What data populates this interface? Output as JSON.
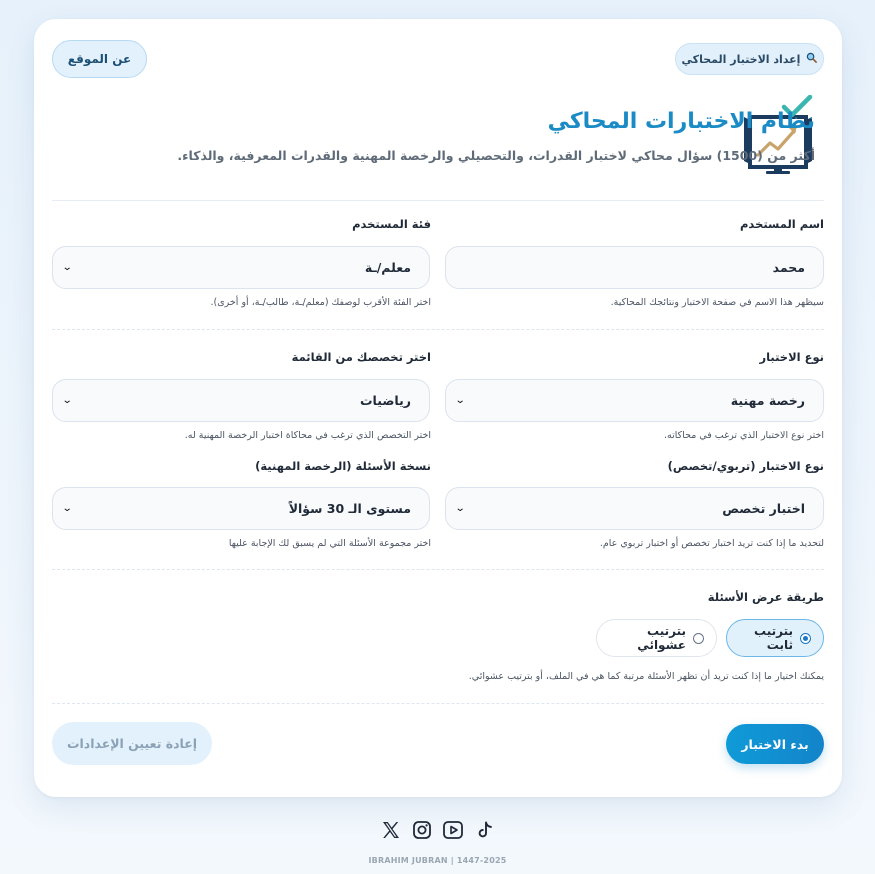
{
  "header": {
    "badge_label": "إعداد الاختبار المحاكي",
    "badge_icon": "magnifier-icon",
    "about_label": "عن الموقع",
    "title": "نظام الاختبارات المحاكي",
    "subtitle": "أكثر من (1500) سؤال محاكي لاختبار القدرات، والتحصيلي والرخصة المهنية والقدرات المعرفية، والذكاء."
  },
  "form": {
    "username": {
      "label": "اسم المستخدم",
      "value": "محمد",
      "hint": "سيظهر هذا الاسم في صفحة الاختبار ونتائجك المحاكية."
    },
    "user_category": {
      "label": "فئة المستخدم",
      "value": "معلم/ـة",
      "hint": "اختر الفئة الأقرب لوصفك (معلم/ـة، طالب/ـة، أو أخرى)."
    },
    "test_type": {
      "label": "نوع الاختبار",
      "value": "رخصة مهنية",
      "hint": "اختر نوع الاختبار الذي ترغب في محاكاته."
    },
    "specialty": {
      "label": "اختر تخصصك من القائمة",
      "value": "رياضيات",
      "hint": "اختر التخصص الذي ترغب في محاكاة اختبار الرخصة المهنية له."
    },
    "test_kind": {
      "label": "نوع الاختبار (تربوي/تخصص)",
      "value": "اختبار تخصص",
      "hint": "لتحديد ما إذا كنت تريد اختبار تخصص أو اختبار تربوي عام."
    },
    "question_version": {
      "label": "نسخة الأسئلة (الرخصة المهنية)",
      "value": "مستوى الـ 30 سؤالاً",
      "hint": "اختر مجموعة الأسئلة التي لم يسبق لك الإجابة عليها"
    },
    "display_method": {
      "label": "طريقة عرض الأسئلة",
      "option_fixed": "بترتيب ثابت",
      "option_random": "بترتيب عشوائي",
      "selected": "بترتيب ثابت",
      "hint": "يمكنك اختيار ما إذا كنت تريد أن تظهر الأسئلة مرتبة كما هي في الملف، أو بترتيب عشوائي."
    }
  },
  "actions": {
    "start_label": "بدء الاختبار",
    "reset_label": "إعادة تعيين الإعدادات"
  },
  "footer": {
    "social_icons": [
      "x-icon",
      "instagram-icon",
      "youtube-icon",
      "tiktok-icon"
    ],
    "credit": "IBRAHIM JUBRAN | 1447-2025"
  },
  "colors": {
    "accent": "#1b8bc5",
    "primary_button": "#1384c9",
    "logo_navy": "#1c3c5f",
    "logo_teal": "#3ab5b0",
    "logo_gold": "#c9a46a"
  }
}
